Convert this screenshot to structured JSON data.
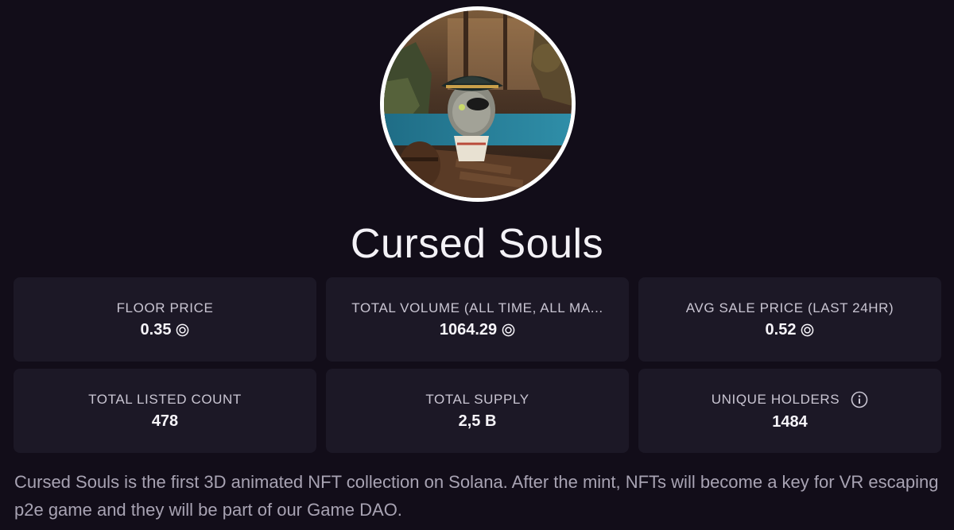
{
  "collection": {
    "name": "Cursed Souls",
    "avatar_alt": "Cursed Souls collection avatar",
    "description": "Cursed Souls is the first 3D animated NFT collection on Solana. After the mint, NFTs will become a key for VR escaping p2e game and they will be part of our Game DAO."
  },
  "stats": [
    {
      "label": "FLOOR PRICE",
      "value": "0.35",
      "icon": "solana-icon"
    },
    {
      "label": "TOTAL VOLUME (ALL TIME, ALL MA...",
      "value": "1064.29",
      "icon": "solana-icon"
    },
    {
      "label": "AVG SALE PRICE (LAST 24HR)",
      "value": "0.52",
      "icon": "solana-icon"
    },
    {
      "label": "TOTAL LISTED COUNT",
      "value": "478"
    },
    {
      "label": "TOTAL SUPPLY",
      "value": "2,5 B"
    },
    {
      "label": "UNIQUE HOLDERS",
      "value": "1484",
      "label_icon": "info-icon"
    }
  ],
  "colors": {
    "background": "#120d19",
    "card": "#1c1826",
    "title": "#f4f2f7",
    "label": "#c9c5d2",
    "description": "#a8a3b3"
  }
}
